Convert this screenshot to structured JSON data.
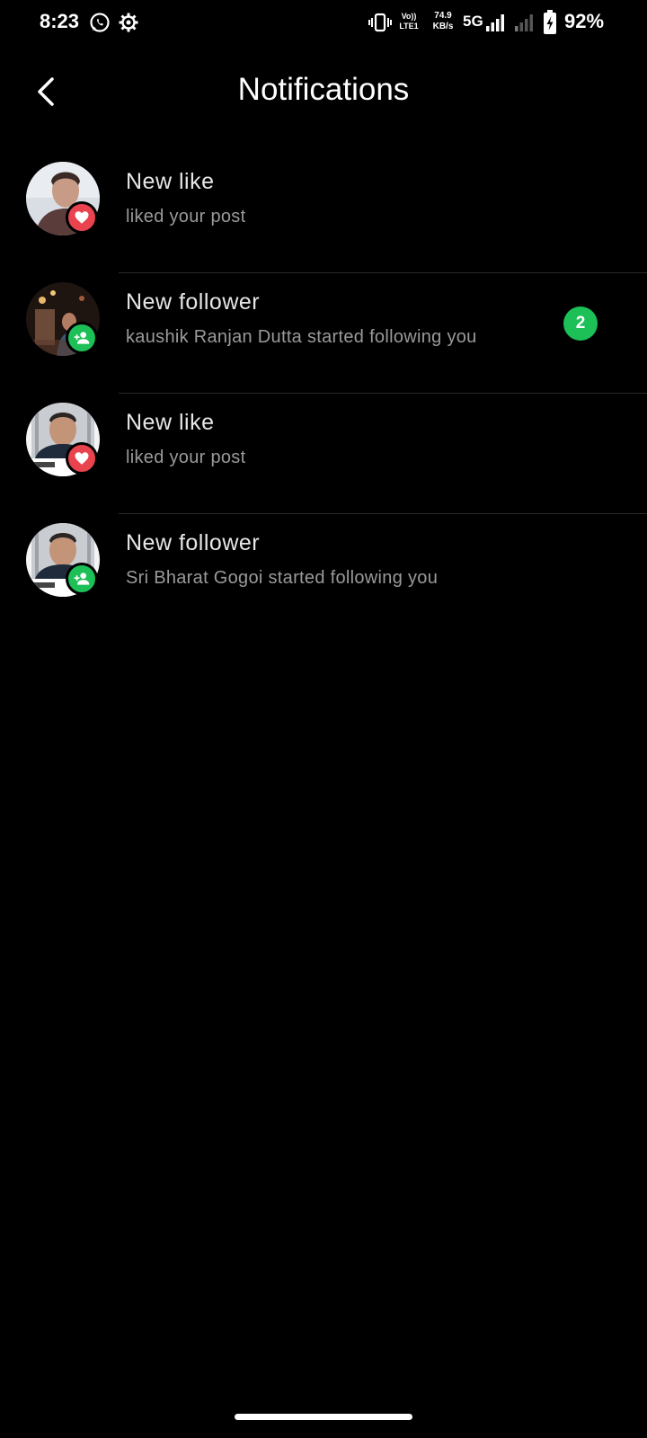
{
  "status_bar": {
    "time": "8:23",
    "volte_top": "Vo))",
    "volte_bottom": "LTE1",
    "speed_value": "74.9",
    "speed_unit": "KB/s",
    "network": "5G",
    "battery": "92%",
    "icons": [
      "whatsapp-icon",
      "settings-gear-icon",
      "vibrate-icon",
      "signal-icon",
      "signal-weak-icon",
      "battery-charging-icon"
    ]
  },
  "header": {
    "title": "Notifications",
    "back_icon": "chevron-left-icon"
  },
  "notifications": [
    {
      "title": "New like",
      "body": "liked your post",
      "type": "like",
      "badge_icon": "heart-icon",
      "badge_color": "#e8434f",
      "unread_count": ""
    },
    {
      "title": "New follower",
      "body": "kaushik Ranjan Dutta started following you",
      "type": "follow",
      "badge_icon": "person-add-icon",
      "badge_color": "#1dbf57",
      "unread_count": "2"
    },
    {
      "title": "New like",
      "body": "liked your post",
      "type": "like",
      "badge_icon": "heart-icon",
      "badge_color": "#e8434f",
      "unread_count": ""
    },
    {
      "title": "New follower",
      "body": "Sri Bharat Gogoi started following you",
      "type": "follow",
      "badge_icon": "person-add-icon",
      "badge_color": "#1dbf57",
      "unread_count": ""
    }
  ],
  "colors": {
    "background": "#000000",
    "like": "#e8434f",
    "follow": "#1dbf57"
  }
}
